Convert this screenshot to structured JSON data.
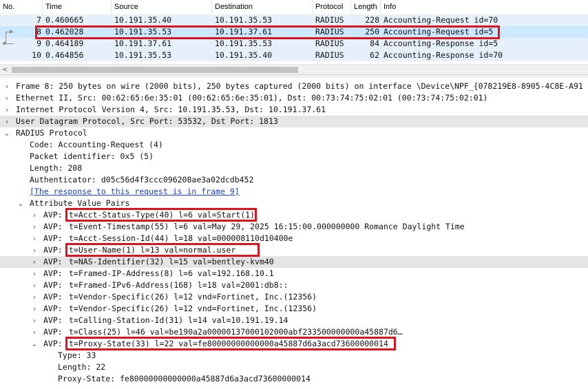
{
  "packet_list": {
    "columns": [
      "No.",
      "Time",
      "Source",
      "Destination",
      "Protocol",
      "Length",
      "Info"
    ],
    "rows": [
      {
        "no": "7",
        "time": "0.460665",
        "source": "10.191.35.40",
        "destination": "10.191.35.53",
        "protocol": "RADIUS",
        "length": "228",
        "info": "Accounting-Request id=70"
      },
      {
        "no": "8",
        "time": "0.462028",
        "source": "10.191.35.53",
        "destination": "10.191.37.61",
        "protocol": "RADIUS",
        "length": "250",
        "info": "Accounting-Request id=5"
      },
      {
        "no": "9",
        "time": "0.464189",
        "source": "10.191.37.61",
        "destination": "10.191.35.53",
        "protocol": "RADIUS",
        "length": "84",
        "info": "Accounting-Response id=5"
      },
      {
        "no": "10",
        "time": "0.464856",
        "source": "10.191.35.53",
        "destination": "10.191.35.40",
        "protocol": "RADIUS",
        "length": "62",
        "info": "Accounting-Response id=70"
      }
    ],
    "selected_row_color": "#cce8ff",
    "scroll_left_arrow": "<"
  },
  "details": {
    "frame": "Frame 8: 250 bytes on wire (2000 bits), 250 bytes captured (2000 bits) on interface \\Device\\NPF_{078219E8-8905-4C8E-A91",
    "ethernet": "Ethernet II, Src: 00:62:65:6e:35:01 (00:62:65:6e:35:01), Dst: 00:73:74:75:02:01 (00:73:74:75:02:01)",
    "ip": "Internet Protocol Version 4, Src: 10.191.35.53, Dst: 10.191.37.61",
    "udp": "User Datagram Protocol, Src Port: 53532, Dst Port: 1813",
    "radius": "RADIUS Protocol",
    "code": "Code: Accounting-Request (4)",
    "packet_id": "Packet identifier: 0x5 (5)",
    "length": "Length: 208",
    "authenticator": "Authenticator: d05c56d4f3ccc096208ae3a02dcdb452",
    "response_link": "[The response to this request is in frame 9]",
    "avp_header": "Attribute Value Pairs",
    "avp_label": "AVP:",
    "avps": [
      "t=Acct-Status-Type(40) l=6 val=Start(1)",
      "t=Event-Timestamp(55) l=6 val=May 29, 2025 16:15:00.000000000 Romance Daylight Time",
      "t=Acct-Session-Id(44) l=18 val=000008110d10400e",
      "t=User-Name(1) l=13 val=normal.user",
      "t=NAS-Identifier(32) l=15 val=bentley-kvm40",
      "t=Framed-IP-Address(8) l=6 val=192.168.10.1",
      "t=Framed-IPv6-Address(168) l=18 val=2001:db8::",
      "t=Vendor-Specific(26) l=12 vnd=Fortinet, Inc.(12356)",
      "t=Vendor-Specific(26) l=12 vnd=Fortinet, Inc.(12356)",
      "t=Calling-Station-Id(31) l=14 val=10.191.19.14",
      "t=Class(25) l=46 val=be190a2a00000137000102000abf233500000000a45887d6…",
      "t=Proxy-State(33) l=22 val=fe80000000000000a45887d6a3acd73600000014"
    ],
    "proxy_type": "Type: 33",
    "proxy_length": "Length: 22",
    "proxy_state": "Proxy-State: fe80000000000000a45887d6a3acd73600000014"
  },
  "icons": {
    "expand": "›",
    "expanded": "⌄"
  },
  "colors": {
    "annotation_red": "#e0121c",
    "highlight_row": "#e5e5e5",
    "link_blue": "#1a3fd6"
  }
}
